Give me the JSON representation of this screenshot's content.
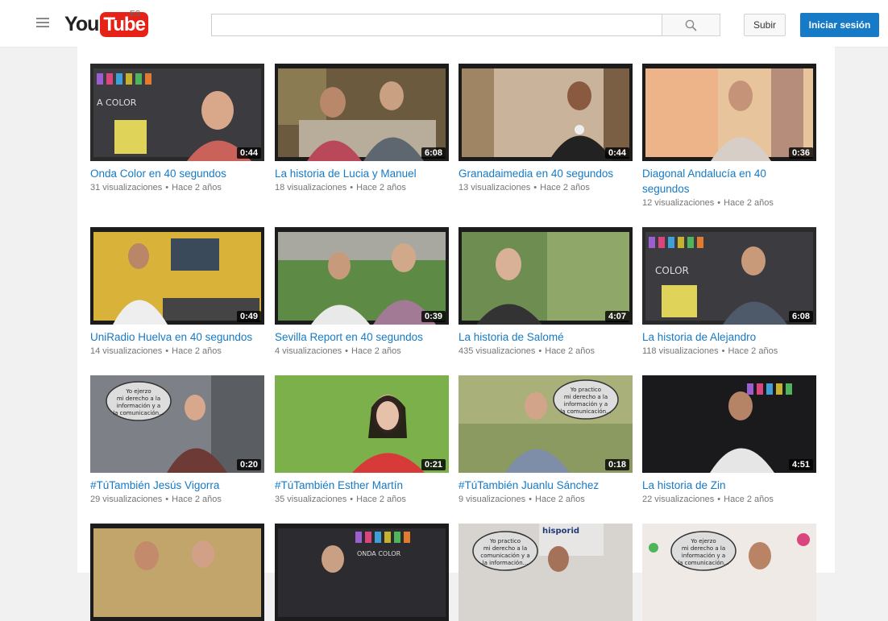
{
  "header": {
    "logo_you": "You",
    "logo_tube": "Tube",
    "country": "ES",
    "search_placeholder": "",
    "upload_label": "Subir",
    "signin_label": "Iniciar sesión"
  },
  "videos": [
    {
      "title": "Onda Color en 40 segundos",
      "views": "31 visualizaciones",
      "age": "Hace 2 años",
      "duration": "0:44"
    },
    {
      "title": "La historia de Lucia y Manuel",
      "views": "18 visualizaciones",
      "age": "Hace 2 años",
      "duration": "6:08"
    },
    {
      "title": "Granadaimedia en 40 segundos",
      "views": "13 visualizaciones",
      "age": "Hace 2 años",
      "duration": "0:44"
    },
    {
      "title": "Diagonal Andalucía en 40 segundos",
      "views": "12 visualizaciones",
      "age": "Hace 2 años",
      "duration": "0:36"
    },
    {
      "title": "UniRadio Huelva en 40 segundos",
      "views": "14 visualizaciones",
      "age": "Hace 2 años",
      "duration": "0:49"
    },
    {
      "title": "Sevilla Report en 40 segundos",
      "views": "4 visualizaciones",
      "age": "Hace 2 años",
      "duration": "0:39"
    },
    {
      "title": "La historia de Salomé",
      "views": "435 visualizaciones",
      "age": "Hace 2 años",
      "duration": "4:07"
    },
    {
      "title": "La historia de Alejandro",
      "views": "118 visualizaciones",
      "age": "Hace 2 años",
      "duration": "6:08"
    },
    {
      "title": "#TúTambién Jesús Vigorra",
      "views": "29 visualizaciones",
      "age": "Hace 2 años",
      "duration": "0:20"
    },
    {
      "title": "#TúTambién Esther Martín",
      "views": "35 visualizaciones",
      "age": "Hace 2 años",
      "duration": "0:21"
    },
    {
      "title": "#TúTambién Juanlu Sánchez",
      "views": "9 visualizaciones",
      "age": "Hace 2 años",
      "duration": "0:18"
    },
    {
      "title": "La historia de Zin",
      "views": "22 visualizaciones",
      "age": "Hace 2 años",
      "duration": "4:51"
    },
    {
      "title": "",
      "views": "",
      "age": "",
      "duration": ""
    },
    {
      "title": "",
      "views": "",
      "age": "",
      "duration": ""
    },
    {
      "title": "",
      "views": "",
      "age": "",
      "duration": ""
    },
    {
      "title": "",
      "views": "",
      "age": "",
      "duration": ""
    }
  ],
  "meta_separator": "•",
  "colors": {
    "link": "#167ac6",
    "meta": "#767676",
    "signin_bg": "#167ac6",
    "logo_red": "#e62117"
  }
}
